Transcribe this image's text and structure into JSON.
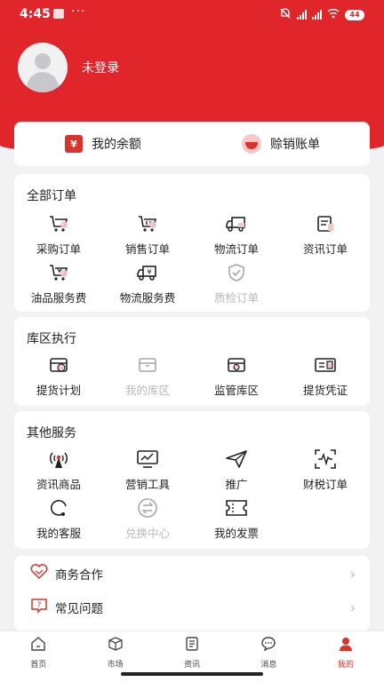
{
  "status_bar": {
    "time": "4:45",
    "battery": "44"
  },
  "profile": {
    "login_status": "未登录"
  },
  "balance_card": {
    "balance_label": "我的余额",
    "write_off_label": "赊销账单"
  },
  "orders": {
    "title": "全部订单",
    "items": [
      {
        "label": "采购订单",
        "icon": "cart-icon",
        "disabled": false
      },
      {
        "label": "销售订单",
        "icon": "cart-icon",
        "disabled": false
      },
      {
        "label": "物流订单",
        "icon": "truck-icon",
        "disabled": false
      },
      {
        "label": "资讯订单",
        "icon": "news-doc-icon",
        "disabled": false
      },
      {
        "label": "油品服务费",
        "icon": "cart-oil-icon",
        "disabled": false
      },
      {
        "label": "物流服务费",
        "icon": "truck-yen-icon",
        "disabled": false
      },
      {
        "label": "质检订单",
        "icon": "shield-check-icon",
        "disabled": true
      }
    ]
  },
  "warehouse": {
    "title": "库区执行",
    "items": [
      {
        "label": "提货计划",
        "icon": "box-clock-icon",
        "disabled": false
      },
      {
        "label": "我的库区",
        "icon": "box-icon",
        "disabled": true
      },
      {
        "label": "监管库区",
        "icon": "box-eye-icon",
        "disabled": false
      },
      {
        "label": "提货凭证",
        "icon": "voucher-icon",
        "disabled": false
      }
    ]
  },
  "services": {
    "title": "其他服务",
    "items": [
      {
        "label": "资讯商品",
        "icon": "broadcast-icon",
        "disabled": false
      },
      {
        "label": "营销工具",
        "icon": "monitor-chart-icon",
        "disabled": false
      },
      {
        "label": "推广",
        "icon": "paper-plane-icon",
        "disabled": false
      },
      {
        "label": "财税订单",
        "icon": "scan-wave-icon",
        "disabled": false
      },
      {
        "label": "我的客服",
        "icon": "headset-icon",
        "disabled": false
      },
      {
        "label": "兑换中心",
        "icon": "exchange-icon",
        "disabled": true
      },
      {
        "label": "我的发票",
        "icon": "ticket-icon",
        "disabled": false
      }
    ]
  },
  "list": [
    {
      "label": "商务合作",
      "icon": "handshake-icon"
    },
    {
      "label": "常见问题",
      "icon": "question-icon"
    }
  ],
  "tabs": [
    {
      "label": "首页",
      "icon": "home-icon",
      "active": false
    },
    {
      "label": "市场",
      "icon": "cube-icon",
      "active": false
    },
    {
      "label": "资讯",
      "icon": "doc-icon",
      "active": false
    },
    {
      "label": "消息",
      "icon": "chat-icon",
      "active": false
    },
    {
      "label": "我的",
      "icon": "user-icon",
      "active": true
    }
  ],
  "colors": {
    "brand_red": "#e0252b",
    "accent_pink": "#f6c7c4",
    "disabled_gray": "#b8b8b8"
  }
}
